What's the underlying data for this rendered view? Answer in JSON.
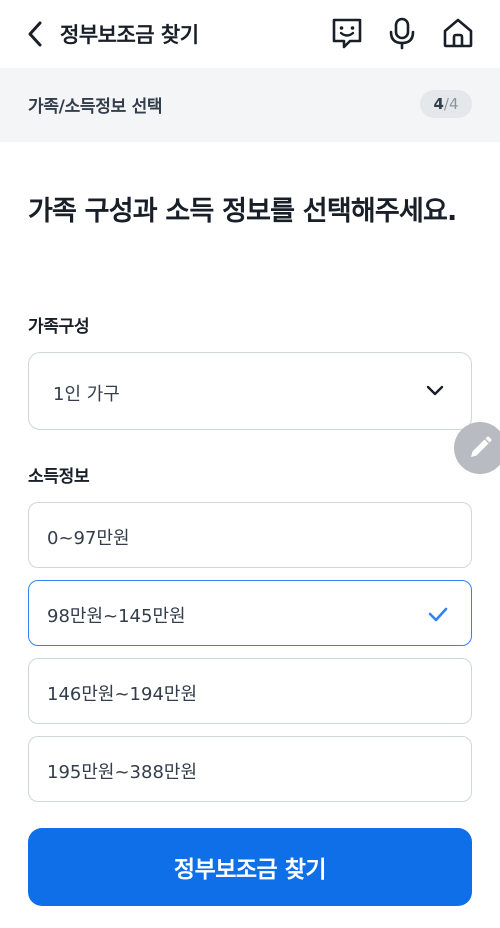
{
  "header": {
    "title": "정부보조금 찾기",
    "icons": [
      "back-arrow-icon",
      "chatbot-face-icon",
      "microphone-icon",
      "home-icon"
    ]
  },
  "step": {
    "label": "가족/소득정보 선택",
    "current": "4",
    "separator": "/",
    "total": "4"
  },
  "question": "가족 구성과 소득 정보를 선택해주세요.",
  "family": {
    "label": "가족구성",
    "selected": "1인 가구"
  },
  "income": {
    "label": "소득정보",
    "options": [
      {
        "label": "0~97만원",
        "selected": false
      },
      {
        "label": "98만원~145만원",
        "selected": true
      },
      {
        "label": "146만원~194만원",
        "selected": false
      },
      {
        "label": "195만원~388만원",
        "selected": false
      }
    ]
  },
  "submit_label": "정부보조금 찾기",
  "colors": {
    "accent": "#3182f6",
    "primary_button": "#0f6fe8",
    "step_bar_bg": "#f4f5f7"
  }
}
